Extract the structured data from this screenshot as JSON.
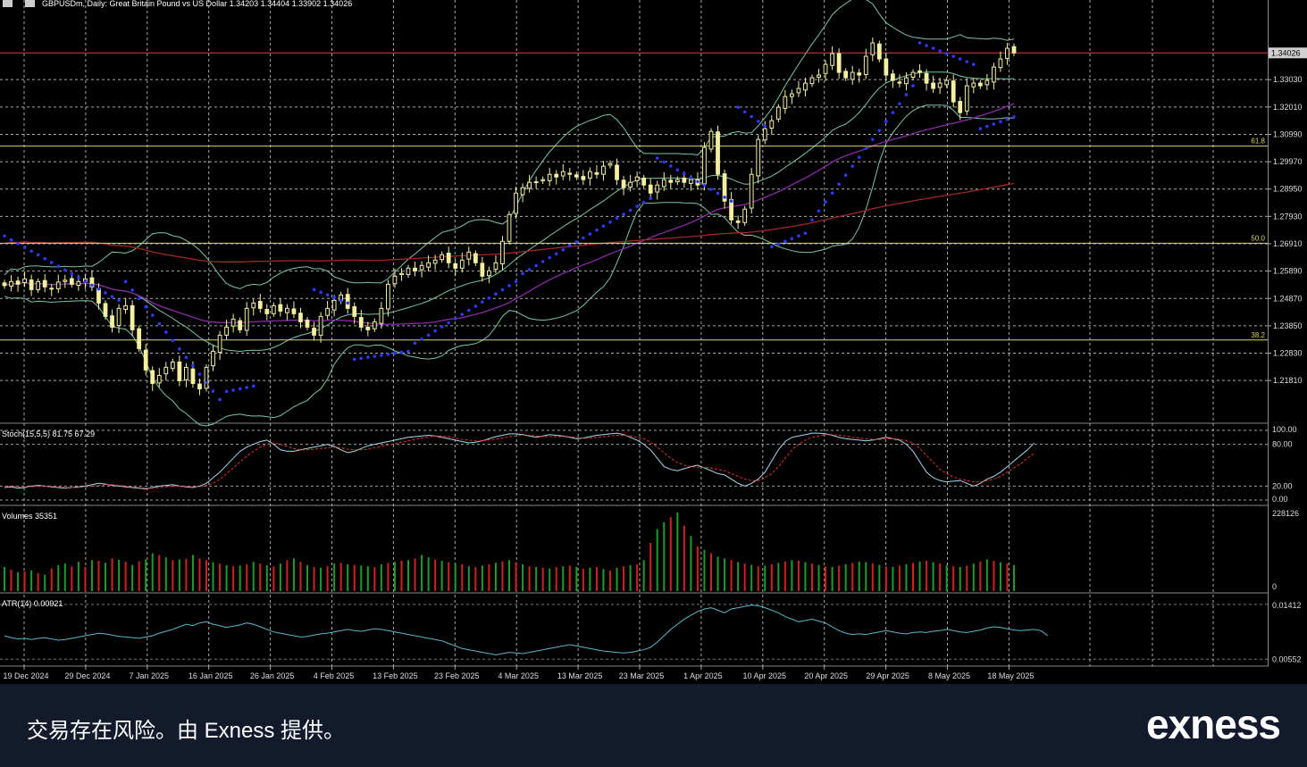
{
  "symbol_header": "GBPUSDm, Daily:  Great Britain Pound vs US Dollar  1.34203 1.34404 1.33902 1.34026",
  "footer": {
    "disclaimer": "交易存在风险。由 Exness 提供。",
    "logo": "exness"
  },
  "colors": {
    "background": "#000000",
    "bull_candle": "#f5f0a0",
    "bear_candle": "#f5f0a0",
    "price_line": "#e03a3a",
    "fib_line": "#d8d860",
    "parabolic_sar": "#2b3aff",
    "bollinger": "#78c8a0",
    "ma_purple": "#8a2aa8",
    "ma_red": "#a02828",
    "stoch_main": "#a8d8f0",
    "stoch_signal": "#e03030",
    "volume_up": "#1c9c2c",
    "volume_down": "#d02020",
    "atr": "#58b8c8",
    "grid": "#c8c8c8",
    "footer_bg": "#121a2b"
  },
  "chart_data": [
    {
      "type": "candlestick",
      "panel": "main",
      "title": "GBPUSDm, Daily:  Great Britain Pound vs US Dollar  1.34203 1.34404 1.33902 1.34026",
      "current_price_label": "1.34026",
      "y_ticks": [
        "1.33030",
        "1.32010",
        "1.30990",
        "1.29970",
        "1.28950",
        "1.27930",
        "1.26910",
        "1.25890",
        "1.24870",
        "1.23850",
        "1.22830",
        "1.21810"
      ],
      "ylim": [
        1.2035,
        1.356
      ],
      "x_tick_labels": [
        "19 Dec 2024",
        "29 Dec 2024",
        "7 Jan 2025",
        "16 Jan 2025",
        "26 Jan 2025",
        "4 Feb 2025",
        "13 Feb 2025",
        "23 Feb 2025",
        "4 Mar 2025",
        "13 Mar 2025",
        "23 Mar 2025",
        "1 Apr 2025",
        "10 Apr 2025",
        "20 Apr 2025",
        "29 Apr 2025",
        "8 May 2025",
        "18 May 2025"
      ],
      "fib_levels": [
        {
          "label": "61.8",
          "value": 1.3055
        },
        {
          "label": "50.0",
          "value": 1.2693
        },
        {
          "label": "38.2",
          "value": 1.2332
        }
      ],
      "current_price": 1.34026,
      "close_series": [
        1.2535,
        1.255,
        1.254,
        1.256,
        1.252,
        1.255,
        1.253,
        1.2525,
        1.2548,
        1.2555,
        1.254,
        1.255,
        1.256,
        1.253,
        1.247,
        1.242,
        1.238,
        1.245,
        1.246,
        1.237,
        1.23,
        1.222,
        1.217,
        1.22,
        1.223,
        1.225,
        1.218,
        1.223,
        1.217,
        1.215,
        1.223,
        1.229,
        1.235,
        1.238,
        1.241,
        1.237,
        1.245,
        1.247,
        1.245,
        1.243,
        1.246,
        1.244,
        1.245,
        1.243,
        1.24,
        1.238,
        1.235,
        1.242,
        1.245,
        1.248,
        1.25,
        1.245,
        1.242,
        1.238,
        1.237,
        1.24,
        1.245,
        1.254,
        1.257,
        1.258,
        1.26,
        1.259,
        1.261,
        1.262,
        1.263,
        1.265,
        1.262,
        1.26,
        1.263,
        1.266,
        1.262,
        1.257,
        1.259,
        1.262,
        1.27,
        1.28,
        1.288,
        1.29,
        1.292,
        1.292,
        1.293,
        1.295,
        1.294,
        1.296,
        1.295,
        1.294,
        1.293,
        1.296,
        1.295,
        1.298,
        1.299,
        1.293,
        1.29,
        1.292,
        1.294,
        1.291,
        1.288,
        1.291,
        1.293,
        1.292,
        1.293,
        1.292,
        1.293,
        1.291,
        1.305,
        1.311,
        1.295,
        1.285,
        1.278,
        1.277,
        1.282,
        1.295,
        1.308,
        1.312,
        1.315,
        1.32,
        1.324,
        1.325,
        1.327,
        1.329,
        1.331,
        1.332,
        1.336,
        1.34,
        1.333,
        1.331,
        1.333,
        1.332,
        1.339,
        1.344,
        1.338,
        1.332,
        1.33,
        1.329,
        1.331,
        1.333,
        1.333,
        1.329,
        1.327,
        1.329,
        1.33,
        1.322,
        1.318,
        1.328,
        1.329,
        1.328,
        1.33,
        1.335,
        1.338,
        1.342,
        1.34026
      ],
      "parabolic_sar": [
        {
          "from": 0,
          "to": 17,
          "start": 1.272,
          "end": 1.248
        },
        {
          "from": 18,
          "to": 32,
          "start": 1.255,
          "end": 1.211
        },
        {
          "from": 33,
          "to": 37,
          "start": 1.214,
          "end": 1.216
        },
        {
          "from": 46,
          "to": 51,
          "start": 1.252,
          "end": 1.247
        },
        {
          "from": 52,
          "to": 60,
          "start": 1.226,
          "end": 1.229
        },
        {
          "from": 61,
          "to": 76,
          "start": 1.232,
          "end": 1.255
        },
        {
          "from": 77,
          "to": 96,
          "start": 1.258,
          "end": 1.286
        },
        {
          "from": 97,
          "to": 108,
          "start": 1.301,
          "end": 1.285
        },
        {
          "from": 109,
          "to": 113,
          "start": 1.32,
          "end": 1.313
        },
        {
          "from": 114,
          "to": 119,
          "start": 1.268,
          "end": 1.273
        },
        {
          "from": 120,
          "to": 135,
          "start": 1.278,
          "end": 1.328
        },
        {
          "from": 136,
          "to": 144,
          "start": 1.344,
          "end": 1.336
        },
        {
          "from": 145,
          "to": 153,
          "start": 1.312,
          "end": 1.319
        }
      ]
    },
    {
      "type": "line",
      "panel": "stochastic",
      "title": "Stoch(15,5,5) 81.75 67.29",
      "y_ticks": [
        "100.00",
        "80.00",
        "20.00",
        "0.00"
      ],
      "ylim": [
        0,
        100
      ],
      "series": [
        {
          "name": "main",
          "values": [
            18,
            19,
            17,
            18,
            20,
            21,
            20,
            19,
            18,
            17,
            18,
            19,
            20,
            22,
            24,
            23,
            21,
            20,
            19,
            18,
            17,
            16,
            18,
            20,
            21,
            22,
            20,
            19,
            18,
            20,
            24,
            32,
            40,
            50,
            60,
            70,
            76,
            80,
            84,
            86,
            80,
            72,
            70,
            70,
            72,
            74,
            76,
            78,
            80,
            77,
            72,
            68,
            70,
            74,
            78,
            80,
            82,
            84,
            86,
            88,
            90,
            91,
            92,
            93,
            92,
            90,
            88,
            86,
            84,
            82,
            83,
            85,
            88,
            91,
            93,
            95,
            95,
            94,
            92,
            90,
            92,
            94,
            93,
            92,
            90,
            88,
            89,
            91,
            93,
            94,
            95,
            96,
            94,
            90,
            86,
            80,
            72,
            60,
            48,
            44,
            42,
            45,
            48,
            50,
            46,
            42,
            38,
            36,
            30,
            24,
            20,
            24,
            30,
            40,
            56,
            72,
            84,
            90,
            92,
            94,
            96,
            96,
            95,
            93,
            90,
            88,
            87,
            86,
            85,
            86,
            88,
            90,
            88,
            86,
            80,
            70,
            55,
            40,
            32,
            28,
            26,
            27,
            28,
            24,
            20,
            24,
            30,
            34,
            40,
            48,
            56,
            64,
            72,
            81.75
          ]
        },
        {
          "name": "signal",
          "values": [
            20,
            20,
            19,
            19,
            19,
            20,
            20,
            20,
            19,
            18,
            18,
            18,
            19,
            20,
            21,
            22,
            22,
            21,
            20,
            19,
            18,
            17,
            17,
            18,
            19,
            20,
            20,
            20,
            19,
            19,
            21,
            24,
            30,
            38,
            46,
            55,
            63,
            70,
            76,
            80,
            82,
            80,
            77,
            74,
            72,
            72,
            73,
            74,
            75,
            76,
            75,
            73,
            72,
            72,
            73,
            75,
            77,
            79,
            81,
            83,
            85,
            87,
            89,
            91,
            92,
            92,
            91,
            89,
            87,
            86,
            85,
            85,
            86,
            87,
            89,
            91,
            92,
            93,
            93,
            92,
            91,
            91,
            91,
            91,
            91,
            90,
            89,
            89,
            90,
            91,
            92,
            93,
            93,
            92,
            90,
            88,
            83,
            76,
            68,
            60,
            54,
            50,
            48,
            47,
            47,
            46,
            44,
            42,
            38,
            34,
            30,
            28,
            28,
            32,
            38,
            48,
            60,
            72,
            80,
            86,
            90,
            92,
            94,
            94,
            93,
            92,
            90,
            89,
            88,
            87,
            87,
            88,
            88,
            87,
            85,
            82,
            74,
            64,
            54,
            44,
            38,
            33,
            30,
            28,
            26,
            26,
            28,
            30,
            34,
            40,
            46,
            52,
            60,
            67.29
          ]
        }
      ]
    },
    {
      "type": "bar",
      "panel": "volumes",
      "title": "Volumes 35351",
      "y_ticks": [
        "228126",
        "0"
      ],
      "ylim": [
        0,
        228126
      ],
      "values": [
        70000,
        62000,
        55000,
        58000,
        60000,
        52000,
        48000,
        66000,
        75000,
        80000,
        72000,
        85000,
        70000,
        90000,
        88000,
        82000,
        95000,
        91000,
        85000,
        76000,
        86000,
        92000,
        110000,
        105000,
        98000,
        90000,
        92000,
        94000,
        105000,
        95000,
        90000,
        84000,
        80000,
        75000,
        72000,
        74000,
        78000,
        85000,
        80000,
        75000,
        72000,
        80000,
        90000,
        95000,
        85000,
        75000,
        70000,
        68000,
        72000,
        80000,
        82000,
        78000,
        76000,
        74000,
        72000,
        70000,
        78000,
        82000,
        85000,
        88000,
        90000,
        95000,
        105000,
        98000,
        92000,
        88000,
        84000,
        80000,
        78000,
        72000,
        70000,
        74000,
        78000,
        82000,
        86000,
        90000,
        84000,
        78000,
        72000,
        70000,
        68000,
        66000,
        70000,
        72000,
        74000,
        70000,
        65000,
        68000,
        70000,
        64000,
        60000,
        68000,
        72000,
        75000,
        78000,
        90000,
        140000,
        180000,
        200000,
        215000,
        228126,
        190000,
        160000,
        130000,
        120000,
        110000,
        100000,
        95000,
        90000,
        84000,
        80000,
        76000,
        72000,
        74000,
        78000,
        82000,
        86000,
        90000,
        88000,
        84000,
        80000,
        76000,
        72000,
        70000,
        74000,
        78000,
        82000,
        86000,
        84000,
        80000,
        76000,
        72000,
        70000,
        74000,
        78000,
        82000,
        86000,
        88000,
        84000,
        80000,
        76000,
        72000,
        70000,
        74000,
        80000,
        86000,
        92000,
        88000,
        84000,
        80000,
        76000,
        72000,
        35351
      ],
      "up_flags": [
        1,
        0,
        1,
        0,
        1,
        0,
        1,
        0,
        1,
        1,
        0,
        1,
        0,
        1,
        0,
        1,
        0,
        1,
        0,
        1,
        0,
        1,
        1,
        0,
        1,
        0,
        1,
        0,
        1,
        0,
        0,
        1,
        0,
        1,
        0,
        1,
        0,
        1,
        0,
        1,
        0,
        1,
        0,
        1,
        0,
        1,
        0,
        1,
        0,
        1,
        0,
        1,
        0,
        1,
        1,
        0,
        1,
        0,
        1,
        0,
        1,
        0,
        1,
        1,
        0,
        1,
        0,
        1,
        0,
        1,
        0,
        1,
        0,
        1,
        0,
        1,
        0,
        1,
        0,
        1,
        0,
        1,
        0,
        1,
        0,
        1,
        0,
        1,
        0,
        1,
        0,
        1,
        0,
        1,
        0,
        1,
        0,
        1,
        1,
        0,
        1,
        0,
        1,
        0,
        1,
        0,
        1,
        1,
        0,
        1,
        0,
        1,
        0,
        1,
        0,
        1,
        0,
        1,
        0,
        1,
        0,
        1,
        0,
        1,
        0,
        1,
        0,
        1,
        1,
        0,
        1,
        0,
        1,
        0,
        1,
        0,
        1,
        0,
        1,
        0,
        1,
        0,
        1,
        0,
        1,
        0,
        1,
        0,
        1,
        0,
        1,
        0,
        0
      ]
    },
    {
      "type": "line",
      "panel": "atr",
      "title": "ATR(14) 0.00921",
      "y_ticks": [
        "0.01412",
        "0.00552"
      ],
      "ylim": [
        0.005,
        0.0148
      ],
      "series": [
        {
          "name": "ATR(14)",
          "values": [
            0.0092,
            0.0089,
            0.0087,
            0.0088,
            0.0086,
            0.0088,
            0.0089,
            0.0087,
            0.0085,
            0.0086,
            0.0088,
            0.009,
            0.0092,
            0.0094,
            0.0096,
            0.0095,
            0.0093,
            0.0091,
            0.009,
            0.0089,
            0.0088,
            0.009,
            0.0092,
            0.0096,
            0.0099,
            0.0102,
            0.0106,
            0.011,
            0.0108,
            0.0112,
            0.0114,
            0.011,
            0.0108,
            0.0105,
            0.0107,
            0.0109,
            0.0112,
            0.011,
            0.0106,
            0.0102,
            0.0098,
            0.0096,
            0.0094,
            0.0092,
            0.009,
            0.0091,
            0.0093,
            0.0095,
            0.0096,
            0.0098,
            0.01,
            0.0102,
            0.01,
            0.0099,
            0.0101,
            0.0103,
            0.0102,
            0.01,
            0.0098,
            0.0096,
            0.0094,
            0.0092,
            0.009,
            0.0088,
            0.0086,
            0.0084,
            0.008,
            0.0076,
            0.0072,
            0.007,
            0.0068,
            0.0066,
            0.0064,
            0.0062,
            0.0064,
            0.0066,
            0.0065,
            0.0064,
            0.0066,
            0.0068,
            0.007,
            0.0072,
            0.0074,
            0.0076,
            0.0078,
            0.0076,
            0.0074,
            0.0072,
            0.007,
            0.0068,
            0.0067,
            0.0066,
            0.0065,
            0.0066,
            0.0068,
            0.007,
            0.0074,
            0.0082,
            0.0092,
            0.0102,
            0.011,
            0.0118,
            0.0124,
            0.013,
            0.0134,
            0.0136,
            0.0132,
            0.0128,
            0.0134,
            0.0136,
            0.0138,
            0.014,
            0.0139,
            0.0136,
            0.0132,
            0.0128,
            0.0122,
            0.0118,
            0.0114,
            0.0116,
            0.0118,
            0.0115,
            0.0112,
            0.0106,
            0.01,
            0.0096,
            0.0094,
            0.0095,
            0.0094,
            0.0096,
            0.0098,
            0.01,
            0.0098,
            0.0096,
            0.0095,
            0.0097,
            0.0098,
            0.0097,
            0.0099,
            0.01,
            0.0102,
            0.01,
            0.0098,
            0.0097,
            0.0099,
            0.0101,
            0.0104,
            0.0106,
            0.0105,
            0.0103,
            0.0101,
            0.01,
            0.0101,
            0.0102,
            0.01,
            0.00921
          ]
        }
      ]
    }
  ]
}
